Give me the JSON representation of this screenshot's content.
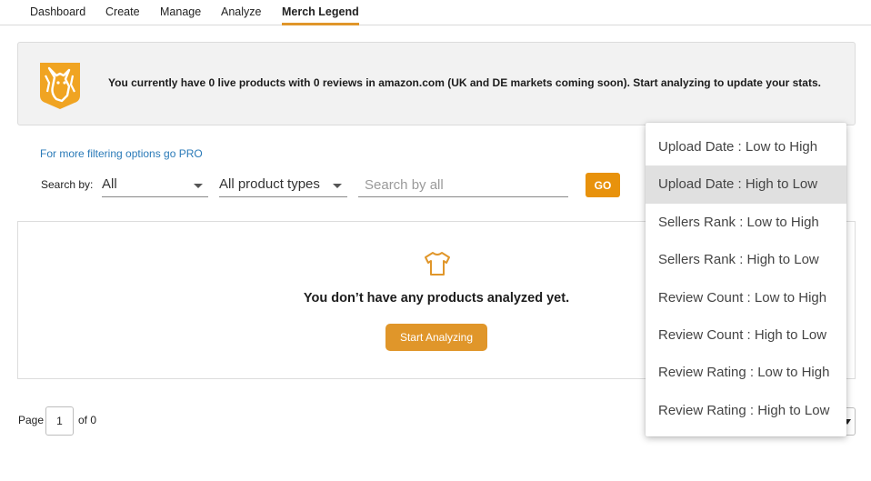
{
  "nav": {
    "tabs": [
      "Dashboard",
      "Create",
      "Manage",
      "Analyze",
      "Merch Legend"
    ],
    "active": "Merch Legend"
  },
  "banner": {
    "message": "You currently have 0 live products with 0 reviews in amazon.com (UK and DE markets coming soon). Start analyzing to update your stats.",
    "logo_icon": "horse-logo-icon"
  },
  "filters": {
    "pro_link": "For more filtering options go PRO",
    "search_by_label": "Search by:",
    "search_by_value": "All",
    "product_type_value": "All product types",
    "search_placeholder": "Search by all",
    "go_label": "GO"
  },
  "empty_state": {
    "icon": "t-shirt-icon",
    "message": "You don’t have any products analyzed yet.",
    "button": "Start Analyzing"
  },
  "pagination": {
    "page_label": "Page",
    "current_page": "1",
    "of_label": "of 0"
  },
  "sort_menu": {
    "options": [
      "Upload Date : Low to High",
      "Upload Date : High to Low",
      "Sellers Rank : Low to High",
      "Sellers Rank : High to Low",
      "Review Count : Low to High",
      "Review Count : High to Low",
      "Review Rating : Low to High",
      "Review Rating : High to Low"
    ],
    "highlighted": "Upload Date : High to Low"
  },
  "colors": {
    "accent": "#e0962a",
    "go_button": "#e8920c",
    "link": "#2a7ab8",
    "logo_bg": "#f0a422"
  }
}
